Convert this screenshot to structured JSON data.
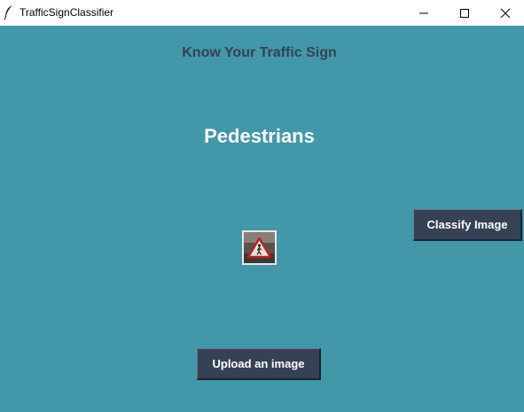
{
  "window": {
    "title": "TrafficSignClassifier",
    "controls": [
      "minimize",
      "maximize",
      "close"
    ]
  },
  "app": {
    "heading": "Know Your Traffic Sign",
    "prediction": "Pedestrians",
    "classify_button": "Classify Image",
    "upload_button": "Upload an image"
  },
  "colors": {
    "background": "#4297a9",
    "button": "#364156",
    "heading_text": "#364156",
    "prediction_text": "#ffffff"
  },
  "icons": {
    "app_icon": "feather-icon",
    "image_preview": "pedestrian-warning-sign-thumbnail"
  }
}
